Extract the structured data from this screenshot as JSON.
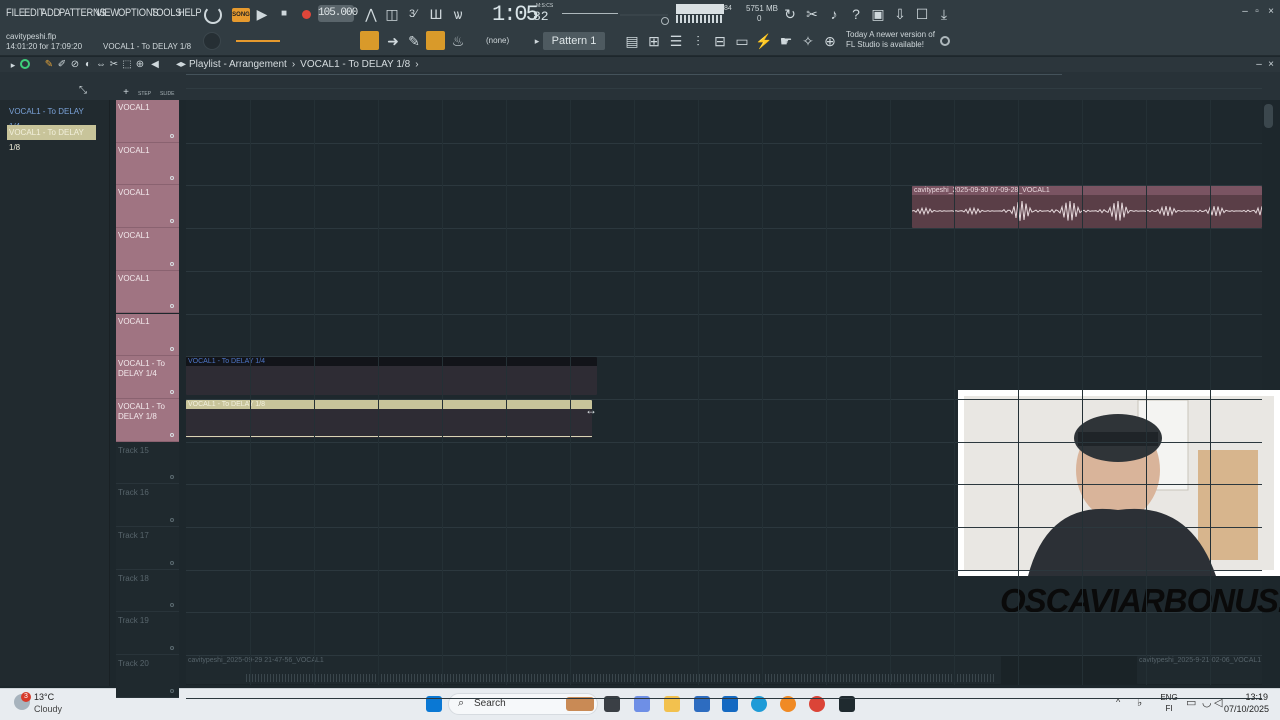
{
  "menu": [
    "FILE",
    "EDIT",
    "ADD",
    "PATTERNS",
    "VIEW",
    "OPTIONS",
    "TOOLS",
    "HELP"
  ],
  "transport": {
    "song_label": "SONG",
    "tempo": "105.000",
    "time_main": "1:05",
    "time_ms": "82",
    "time_units": "M:S:CS",
    "cpu": "84",
    "memory": "5751 MB",
    "voices": "0"
  },
  "project": {
    "file": "cavitypeshi.flp",
    "time_range": "14:01:20 for 17:09:20",
    "current_clip": "VOCAL1 - To DELAY 1/8"
  },
  "toolbar": {
    "snap": "(none)",
    "pattern": "Pattern 1"
  },
  "news": {
    "line1": "Today  A newer version of",
    "line2": "FL Studio is available!"
  },
  "playlist": {
    "title": "Playlist - Arrangement",
    "crumb": "VOCAL1 - To DELAY 1/8",
    "step_label": "STEP",
    "slide_label": "SLIDE"
  },
  "picker": [
    {
      "label": "VOCAL1 - To DELAY 1/4",
      "selected": false
    },
    {
      "label": "VOCAL1 - To DELAY 1/8",
      "selected": true
    }
  ],
  "tracks": [
    {
      "name": "VOCAL1",
      "filled": true
    },
    {
      "name": "VOCAL1",
      "filled": true
    },
    {
      "name": "VOCAL1",
      "filled": true
    },
    {
      "name": "VOCAL1",
      "filled": true
    },
    {
      "name": "VOCAL1",
      "filled": true
    },
    {
      "name": "VOCAL1",
      "filled": true
    },
    {
      "name": "VOCAL1 - To DELAY 1/4",
      "filled": true
    },
    {
      "name": "VOCAL1 - To DELAY 1/8",
      "filled": true
    },
    {
      "name": "Track 15",
      "filled": false
    },
    {
      "name": "Track 16",
      "filled": false
    },
    {
      "name": "Track 17",
      "filled": false
    },
    {
      "name": "Track 18",
      "filled": false
    },
    {
      "name": "Track 19",
      "filled": false
    },
    {
      "name": "Track 20",
      "filled": false
    }
  ],
  "clips": {
    "audio_top": "cavitypeshi_2025-09-30 07-09-28_VOCAL1",
    "delay14": "VOCAL1 - To DELAY 1/4",
    "delay18": "VOCAL1 - To DELAY 1/8",
    "bottom_left": "cavitypeshi_2025-09-29 21-47-56_VOCAL1",
    "bottom_right": "cavitypeshi_2025-9-21-02-06_VOCAL1"
  },
  "overlay": {
    "watermark": "OSCAVIARBONUS.COM"
  },
  "taskbar": {
    "search": "Search",
    "weather_temp": "13°C",
    "weather_cond": "Cloudy",
    "notification_count": "3",
    "lang_line1": "ENG",
    "lang_line2": "FI",
    "time": "13:19",
    "date": "07/10/2025"
  },
  "colors": {
    "track_header": "#a07482",
    "clip_delay14": "#2a2c34",
    "clip_delay18_label": "#c8c49a",
    "clip_audio": "#5a3e47",
    "accent_orange": "#e69a2e"
  }
}
